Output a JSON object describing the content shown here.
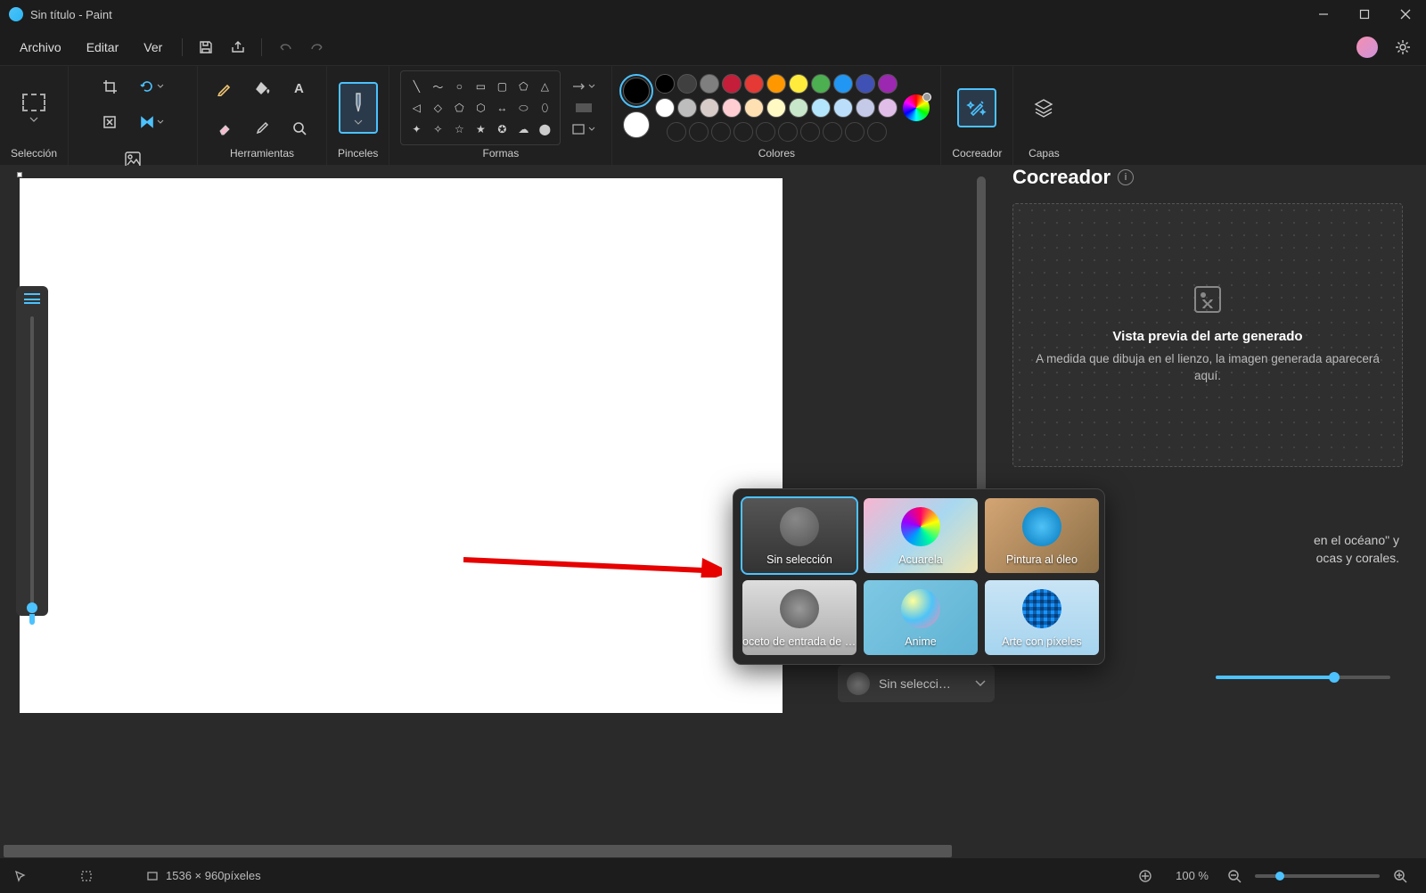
{
  "title": "Sin título - Paint",
  "menu": {
    "file": "Archivo",
    "edit": "Editar",
    "view": "Ver"
  },
  "ribbon": {
    "selection": "Selección",
    "image": "Imagen",
    "tools": "Herramientas",
    "brushes": "Pinceles",
    "shapes": "Formas",
    "colors": "Colores",
    "cocreator": "Cocreador",
    "layers": "Capas"
  },
  "colors": {
    "row1": [
      "#000000",
      "#404040",
      "#7f7f7f",
      "#c41e3a",
      "#e53935",
      "#ff9800",
      "#ffeb3b",
      "#4caf50",
      "#2196f3",
      "#3f51b5",
      "#9c27b0"
    ],
    "row2": [
      "#ffffff",
      "#bdbdbd",
      "#d7ccc8",
      "#ffcdd2",
      "#ffe0b2",
      "#fff9c4",
      "#c8e6c9",
      "#b3e5fc",
      "#bbdefb",
      "#c5cae9",
      "#e1bee7"
    ],
    "primary": "#000000",
    "secondary": "#ffffff"
  },
  "cocreator": {
    "heading": "Cocreador",
    "preview_title": "Vista previa del arte generado",
    "preview_desc": "A medida que dibuja en el lienzo, la imagen generada aparecerá aquí.",
    "hint_l1": "en el océano\" y",
    "hint_l2": "ocas y corales.",
    "style_dropdown": "Sin selecci…",
    "styles": [
      {
        "label": "Sin selección",
        "bg": "bg-none",
        "pal": "pal1",
        "selected": true
      },
      {
        "label": "Acuarela",
        "bg": "bg-acua",
        "pal": "pal2",
        "selected": false
      },
      {
        "label": "Pintura al óleo",
        "bg": "bg-oleo",
        "pal": "pal3",
        "selected": false
      },
      {
        "label": "oceto de entrada de láp",
        "bg": "bg-lapiz",
        "pal": "pal4",
        "selected": false
      },
      {
        "label": "Anime",
        "bg": "bg-anime",
        "pal": "pal5",
        "selected": false
      },
      {
        "label": "Arte con píxeles",
        "bg": "bg-pixel",
        "pal": "pal6",
        "selected": false
      }
    ]
  },
  "status": {
    "canvas_size": "1536 × 960píxeles",
    "zoom": "100 %"
  }
}
